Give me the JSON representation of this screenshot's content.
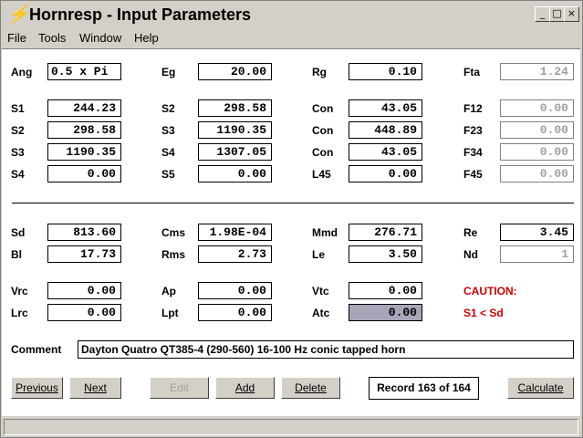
{
  "window": {
    "title": "Hornresp - Input Parameters",
    "controls": {
      "minimize": "_",
      "maximize": "□",
      "close": "×"
    }
  },
  "menu": [
    "File",
    "Tools",
    "Window",
    "Help"
  ],
  "params": {
    "ang": {
      "label": "Ang",
      "value": "0.5 x Pi"
    },
    "eg": {
      "label": "Eg",
      "value": "20.00"
    },
    "rg": {
      "label": "Rg",
      "value": "0.10"
    },
    "fta": {
      "label": "Fta",
      "value": "1.24"
    },
    "s1a": {
      "label": "S1",
      "value": "244.23"
    },
    "s2a": {
      "label": "S2",
      "value": "298.58"
    },
    "con1": {
      "label": "Con",
      "value": "43.05"
    },
    "f12": {
      "label": "F12",
      "value": "0.00"
    },
    "s2b": {
      "label": "S2",
      "value": "298.58"
    },
    "s3a": {
      "label": "S3",
      "value": "1190.35"
    },
    "con2": {
      "label": "Con",
      "value": "448.89"
    },
    "f23": {
      "label": "F23",
      "value": "0.00"
    },
    "s3b": {
      "label": "S3",
      "value": "1190.35"
    },
    "s4a": {
      "label": "S4",
      "value": "1307.05"
    },
    "con3": {
      "label": "Con",
      "value": "43.05"
    },
    "f34": {
      "label": "F34",
      "value": "0.00"
    },
    "s4b": {
      "label": "S4",
      "value": "0.00"
    },
    "s5": {
      "label": "S5",
      "value": "0.00"
    },
    "l45": {
      "label": "L45",
      "value": "0.00"
    },
    "f45": {
      "label": "F45",
      "value": "0.00"
    },
    "sd": {
      "label": "Sd",
      "value": "813.60"
    },
    "cms": {
      "label": "Cms",
      "value": "1.98E-04"
    },
    "mmd": {
      "label": "Mmd",
      "value": "276.71"
    },
    "re": {
      "label": "Re",
      "value": "3.45"
    },
    "bl": {
      "label": "Bl",
      "value": "17.73"
    },
    "rms": {
      "label": "Rms",
      "value": "2.73"
    },
    "le": {
      "label": "Le",
      "value": "3.50"
    },
    "nd": {
      "label": "Nd",
      "value": "1"
    },
    "vrc": {
      "label": "Vrc",
      "value": "0.00"
    },
    "ap": {
      "label": "Ap",
      "value": "0.00"
    },
    "vtc": {
      "label": "Vtc",
      "value": "0.00"
    },
    "lrc": {
      "label": "Lrc",
      "value": "0.00"
    },
    "lpt": {
      "label": "Lpt",
      "value": "0.00"
    },
    "atc": {
      "label": "Atc",
      "value": "0.00"
    }
  },
  "caution": {
    "title": "CAUTION:",
    "message": "S1 < Sd"
  },
  "comment": {
    "label": "Comment",
    "value": "Dayton Quatro QT385-4 (290-560) 16-100 Hz conic tapped horn"
  },
  "buttons": {
    "previous": "Previous",
    "next": "Next",
    "edit": "Edit",
    "add": "Add",
    "delete": "Delete",
    "calculate": "Calculate"
  },
  "record": "Record 163 of 164"
}
